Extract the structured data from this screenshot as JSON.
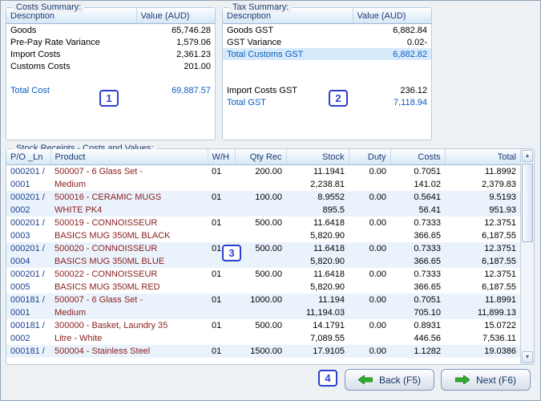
{
  "colors": {
    "accent_blue_text": "#0a5cc2",
    "badge_blue": "#2b3fd0",
    "header_text": "#1b3b72",
    "po_column_text": "#1c3f8f",
    "product_column_text": "#8b2020",
    "highlight_row_bg": "#d7eafb",
    "alt_row_bg": "#eaf3fc",
    "arrow_green": "#2fae2f"
  },
  "costs_summary": {
    "title": "Costs Summary:",
    "columns": [
      "Description",
      "Value (AUD)"
    ],
    "rows": [
      {
        "label": "Goods",
        "value": "65,746.28",
        "cls": ""
      },
      {
        "label": "Pre-Pay Rate Variance",
        "value": "1,579.06",
        "cls": ""
      },
      {
        "label": "Import Costs",
        "value": "2,361.23",
        "cls": ""
      },
      {
        "label": "Customs Costs",
        "value": "201.00",
        "cls": ""
      },
      {
        "label": "",
        "value": "",
        "cls": "blank"
      },
      {
        "label": "Total Cost",
        "value": "69,887.57",
        "cls": "total"
      }
    ],
    "badge": "1"
  },
  "tax_summary": {
    "title": "Tax Summary:",
    "columns": [
      "Description",
      "Value (AUD)"
    ],
    "rows": [
      {
        "label": "Goods GST",
        "value": "6,882.84",
        "cls": ""
      },
      {
        "label": "GST Variance",
        "value": "0.02-",
        "cls": ""
      },
      {
        "label": "Total Customs GST",
        "value": "6,882.82",
        "cls": "total highlight"
      },
      {
        "label": "",
        "value": "",
        "cls": "blank"
      },
      {
        "label": "",
        "value": "",
        "cls": "blank"
      },
      {
        "label": "Import Costs GST",
        "value": "236.12",
        "cls": ""
      },
      {
        "label": "Total GST",
        "value": "7,118.94",
        "cls": "total"
      }
    ],
    "badge": "2"
  },
  "stock_receipts": {
    "title": "Stock Receipts - Costs and Values:",
    "columns": [
      "P/O _Ln",
      "Product",
      "W/H",
      "Qty Rec",
      "Stock",
      "Duty",
      "Costs",
      "Total"
    ],
    "rows": [
      {
        "po": "000201 /",
        "product": "500007 - 6 Glass Set -",
        "wh": "01",
        "qty": "200.00",
        "stock": "11.1941",
        "duty": "0.00",
        "costs": "0.7051",
        "total": "11.8992",
        "cls": ""
      },
      {
        "po": "0001",
        "product": "Medium",
        "stock": "2,238.81",
        "costs": "141.02",
        "total": "2,379.83",
        "cls": ""
      },
      {
        "po": "000201 /",
        "product": "500016 - CERAMIC MUGS",
        "wh": "01",
        "qty": "100.00",
        "stock": "8.9552",
        "duty": "0.00",
        "costs": "0.5641",
        "total": "9.5193",
        "cls": "alt"
      },
      {
        "po": "0002",
        "product": "WHITE PK4",
        "stock": "895.5",
        "costs": "56.41",
        "total": "951.93",
        "cls": "alt"
      },
      {
        "po": "000201 /",
        "product": "500019 - CONNOISSEUR",
        "wh": "01",
        "qty": "500.00",
        "stock": "11.6418",
        "duty": "0.00",
        "costs": "0.7333",
        "total": "12.3751",
        "cls": ""
      },
      {
        "po": "0003",
        "product": "BASICS MUG 350ML BLACK",
        "stock": "5,820.90",
        "costs": "366.65",
        "total": "6,187.55",
        "cls": ""
      },
      {
        "po": "000201 /",
        "product": "500020 - CONNOISSEUR",
        "wh": "01",
        "qty": "500.00",
        "stock": "11.6418",
        "duty": "0.00",
        "costs": "0.7333",
        "total": "12.3751",
        "cls": "alt"
      },
      {
        "po": "0004",
        "product": "BASICS MUG 350ML BLUE",
        "stock": "5,820.90",
        "costs": "366.65",
        "total": "6,187.55",
        "cls": "alt"
      },
      {
        "po": "000201 /",
        "product": "500022 - CONNOISSEUR",
        "wh": "01",
        "qty": "500.00",
        "stock": "11.6418",
        "duty": "0.00",
        "costs": "0.7333",
        "total": "12.3751",
        "cls": ""
      },
      {
        "po": "0005",
        "product": "BASICS MUG 350ML RED",
        "stock": "5,820.90",
        "costs": "366.65",
        "total": "6,187.55",
        "cls": ""
      },
      {
        "po": "000181 /",
        "product": "500007 - 6 Glass Set -",
        "wh": "01",
        "qty": "1000.00",
        "stock": "11.194",
        "duty": "0.00",
        "costs": "0.7051",
        "total": "11.8991",
        "cls": "alt"
      },
      {
        "po": "0001",
        "product": "Medium",
        "stock": "11,194.03",
        "costs": "705.10",
        "total": "11,899.13",
        "cls": "alt"
      },
      {
        "po": "000181 /",
        "product": "300000 - Basket, Laundry 35",
        "wh": "01",
        "qty": "500.00",
        "stock": "14.1791",
        "duty": "0.00",
        "costs": "0.8931",
        "total": "15.0722",
        "cls": ""
      },
      {
        "po": "0002",
        "product": "Litre - White",
        "stock": "7,089.55",
        "costs": "446.56",
        "total": "7,536.11",
        "cls": ""
      },
      {
        "po": "000181 /",
        "product": "500004 - Stainless Steel",
        "wh": "01",
        "qty": "1500.00",
        "stock": "17.9105",
        "duty": "0.00",
        "costs": "1.1282",
        "total": "19.0386",
        "cls": "alt"
      }
    ],
    "badge": "3"
  },
  "scrollbar": {
    "up_icon": "▲",
    "down_icon": "▼"
  },
  "footer": {
    "badge": "4",
    "back_button": {
      "label": "Back (F5)",
      "icon": "green-left-arrow"
    },
    "next_button": {
      "label": "Next (F6)",
      "icon": "green-right-arrow"
    }
  }
}
